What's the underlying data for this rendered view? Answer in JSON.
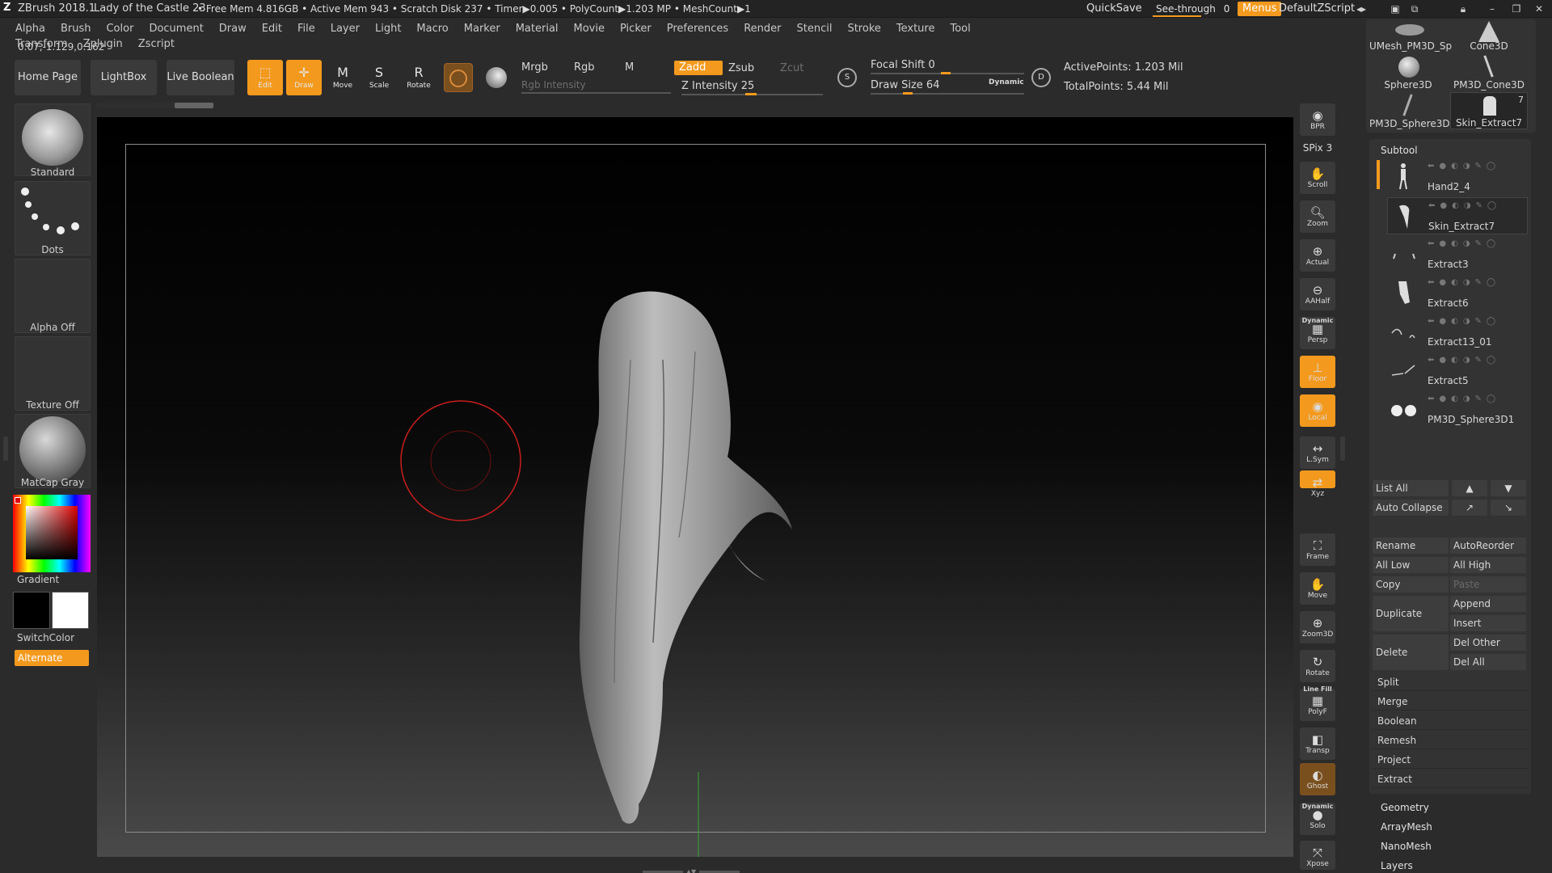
{
  "titlebar": {
    "app": "ZBrush 2018.1",
    "document": "Lady of the Castle 23",
    "stats": "• Free Mem 4.816GB • Active Mem 943 • Scratch Disk 237 • Timer▶0.005 • PolyCount▶1.203 MP  • MeshCount▶1",
    "quicksave": "QuickSave",
    "see_through": "See-through",
    "see_through_value": "0",
    "menus": "Menus",
    "script": "DefaultZScript"
  },
  "menubar": [
    "Alpha",
    "Brush",
    "Color",
    "Document",
    "Draw",
    "Edit",
    "File",
    "Layer",
    "Light",
    "Macro",
    "Marker",
    "Material",
    "Movie",
    "Picker",
    "Preferences",
    "Render",
    "Stencil",
    "Stroke",
    "Texture",
    "Tool",
    "Transform",
    "Zplugin",
    "Zscript"
  ],
  "coords": "0.07,-1.129,0.162",
  "shelf": {
    "home_page": "Home Page",
    "lightbox": "LightBox",
    "live_boolean": "Live Boolean"
  },
  "tools": {
    "edit": "Edit",
    "draw": "Draw",
    "move": "Move",
    "scale": "Scale",
    "rotate": "Rotate"
  },
  "color_controls": {
    "mrgb": "Mrgb",
    "rgb": "Rgb",
    "m": "M",
    "rgb_intensity": "Rgb Intensity",
    "zadd": "Zadd",
    "zsub": "Zsub",
    "zcut": "Zcut",
    "z_intensity_label": "Z Intensity",
    "z_intensity": "25"
  },
  "brush_controls": {
    "focal_shift_label": "Focal Shift",
    "focal_shift": "0",
    "draw_size_label": "Draw Size",
    "draw_size": "64",
    "dynamic": "Dynamic"
  },
  "points": {
    "active": "ActivePoints: 1.203 Mil",
    "total": "TotalPoints: 5.44 Mil"
  },
  "left_tray": {
    "brush": "Standard",
    "stroke": "Dots",
    "alpha": "Alpha Off",
    "texture": "Texture Off",
    "material": "MatCap Gray",
    "gradient": "Gradient",
    "switch_color": "SwitchColor",
    "alternate": "Alternate"
  },
  "right_toolbar": [
    {
      "name": "bpr",
      "label": "BPR"
    },
    {
      "name": "spix",
      "label": "SPix 3"
    },
    {
      "name": "scroll",
      "label": "Scroll"
    },
    {
      "name": "zoom",
      "label": "Zoom"
    },
    {
      "name": "actual",
      "label": "Actual"
    },
    {
      "name": "aahalf",
      "label": "AAHalf"
    },
    {
      "name": "persp",
      "label": "Persp"
    },
    {
      "name": "floor",
      "label": "Floor"
    },
    {
      "name": "local",
      "label": "Local"
    },
    {
      "name": "lsym",
      "label": "L.Sym"
    },
    {
      "name": "xyz",
      "label": "Xyz"
    },
    {
      "name": "frame",
      "label": "Frame"
    },
    {
      "name": "move",
      "label": "Move"
    },
    {
      "name": "zoom3d",
      "label": "Zoom3D"
    },
    {
      "name": "rotate",
      "label": "Rotate"
    },
    {
      "name": "polyf",
      "label": "PolyF"
    },
    {
      "name": "transp",
      "label": "Transp"
    },
    {
      "name": "ghost",
      "label": "Ghost"
    },
    {
      "name": "solo",
      "label": "Solo"
    },
    {
      "name": "xpose",
      "label": "Xpose"
    }
  ],
  "right_toolbar_extra": {
    "dynamic_top": "Dynamic",
    "line_fill": "Line Fill",
    "dynamic_bottom": "Dynamic"
  },
  "tool_thumbs": {
    "umesh": "UMesh_PM3D_Sp",
    "cone": "Cone3D",
    "sphere": "Sphere3D",
    "pm3d_cone": "PM3D_Cone3D",
    "pm3d_sphere": "PM3D_Sphere3D",
    "skin": "Skin_Extract7",
    "skin_count": "7"
  },
  "subtool": {
    "title": "Subtool",
    "items": [
      "Hand2_4",
      "Skin_Extract7",
      "Extract3",
      "Extract6",
      "Extract13_01",
      "Extract5",
      "PM3D_Sphere3D1"
    ]
  },
  "subtool_buttons": {
    "list_all": "List All",
    "auto_collapse": "Auto Collapse",
    "rename": "Rename",
    "auto_reorder": "AutoReorder",
    "all_low": "All Low",
    "all_high": "All High",
    "copy": "Copy",
    "paste": "Paste",
    "duplicate": "Duplicate",
    "append": "Append",
    "insert": "Insert",
    "delete": "Delete",
    "del_other": "Del Other",
    "del_all": "Del All",
    "split": "Split",
    "merge": "Merge",
    "boolean": "Boolean",
    "remesh": "Remesh",
    "project": "Project",
    "extract": "Extract"
  },
  "sections": [
    "Geometry",
    "ArrayMesh",
    "NanoMesh",
    "Layers"
  ],
  "colors": {
    "accent": "#f39a1e",
    "bg": "#2b2b2b",
    "panel": "#333333",
    "brush_cursor": "#c81e1e"
  }
}
